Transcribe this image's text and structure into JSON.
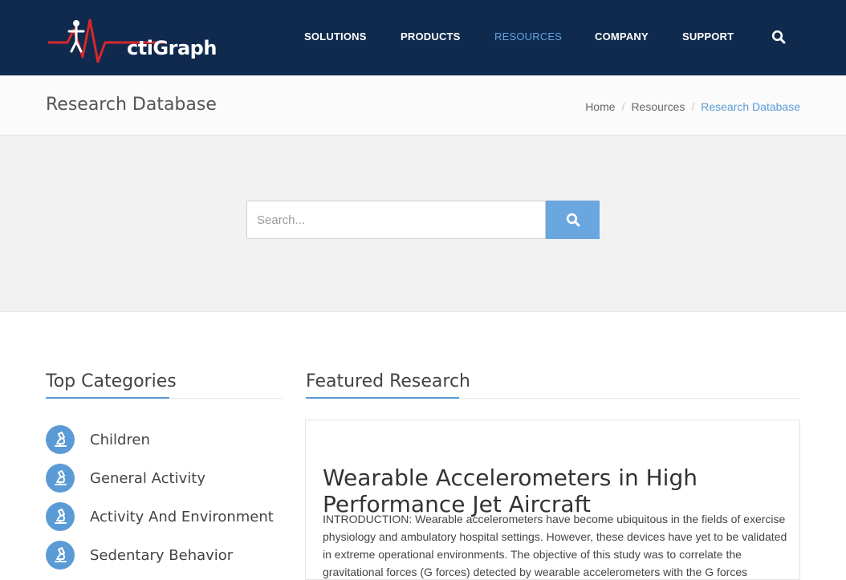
{
  "header": {
    "logo_text": "ctiGraph",
    "nav": [
      "SOLUTIONS",
      "PRODUCTS",
      "RESOURCES",
      "COMPANY",
      "SUPPORT"
    ],
    "active_nav": "RESOURCES",
    "search_icon": "search-icon",
    "colors": {
      "background": "#0f2a4c",
      "active": "#5fa3df",
      "logo_accent": "#d9262c"
    }
  },
  "titlebar": {
    "title": "Research Database",
    "breadcrumb": [
      "Home",
      "Resources",
      "Research Database"
    ]
  },
  "search": {
    "placeholder": "Search...",
    "button_icon": "search-icon",
    "button_color": "#6aa6e0"
  },
  "categories": {
    "heading": "Top Categories",
    "item_icon": "microscope-icon",
    "items": [
      "Children",
      "General Activity",
      "Activity And Environment",
      "Sedentary Behavior"
    ]
  },
  "featured": {
    "heading": "Featured Research",
    "title": "Wearable Accelerometers in High Performance Jet Aircraft",
    "abstract": "INTRODUCTION: Wearable accelerometers have become ubiquitous in the fields of exercise physiology and ambulatory hospital settings. However, these devices have yet to be validated in extreme operational environments. The objective of this study was to correlate the gravitational forces (G forces) detected by wearable accelerometers with the G forces detected by high"
  },
  "accent_color": "#5b9bd5"
}
